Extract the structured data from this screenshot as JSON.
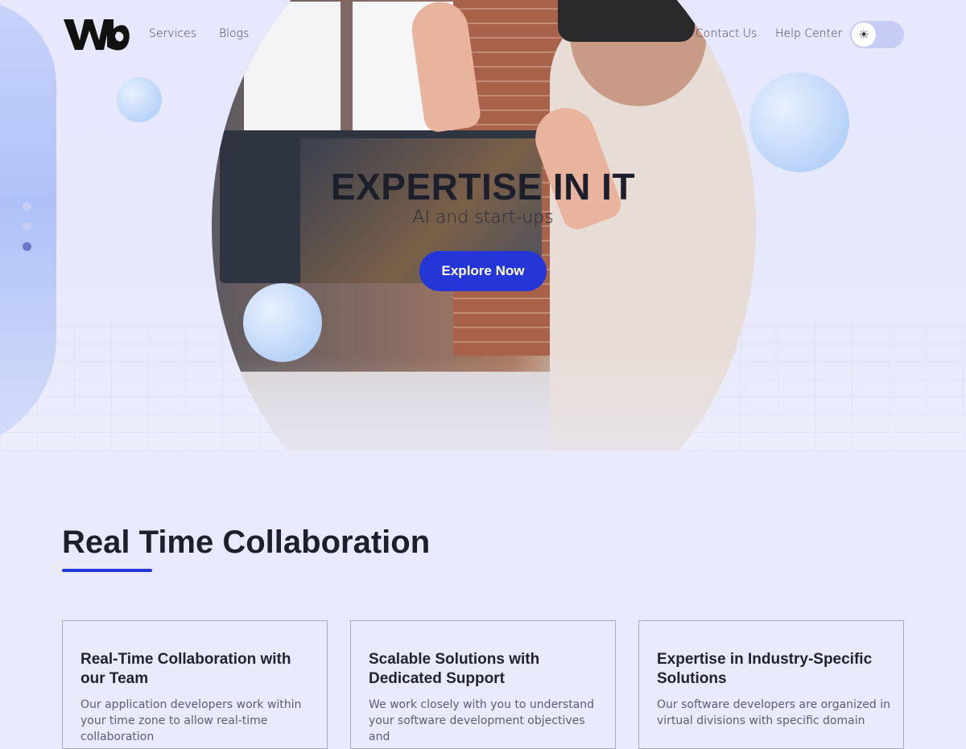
{
  "nav": {
    "logo_text": "WB",
    "left_links": [
      "Services",
      "Blogs"
    ],
    "right_links": [
      "Contact Us",
      "Help Center"
    ],
    "theme_toggle_icon": "sun-icon"
  },
  "hero": {
    "title": "EXPERTISE IN IT",
    "subtitle": "AI and start-ups",
    "cta_label": "Explore Now",
    "slider_dots": 3,
    "active_dot": 3
  },
  "section": {
    "title": "Real Time Collaboration"
  },
  "cards": [
    {
      "title": "Real-Time Collaboration with our Team",
      "text": "Our application developers work within your time zone to allow real-time collaboration"
    },
    {
      "title": "Scalable Solutions with Dedicated Support",
      "text": "We work closely with you to understand your software development objectives and"
    },
    {
      "title": "Expertise in Industry-Specific Solutions",
      "text": "Our software developers are organized in virtual divisions with specific domain"
    }
  ],
  "colors": {
    "accent": "#2536d9",
    "background": "#e9eafc",
    "text": "#1e1f2c"
  }
}
